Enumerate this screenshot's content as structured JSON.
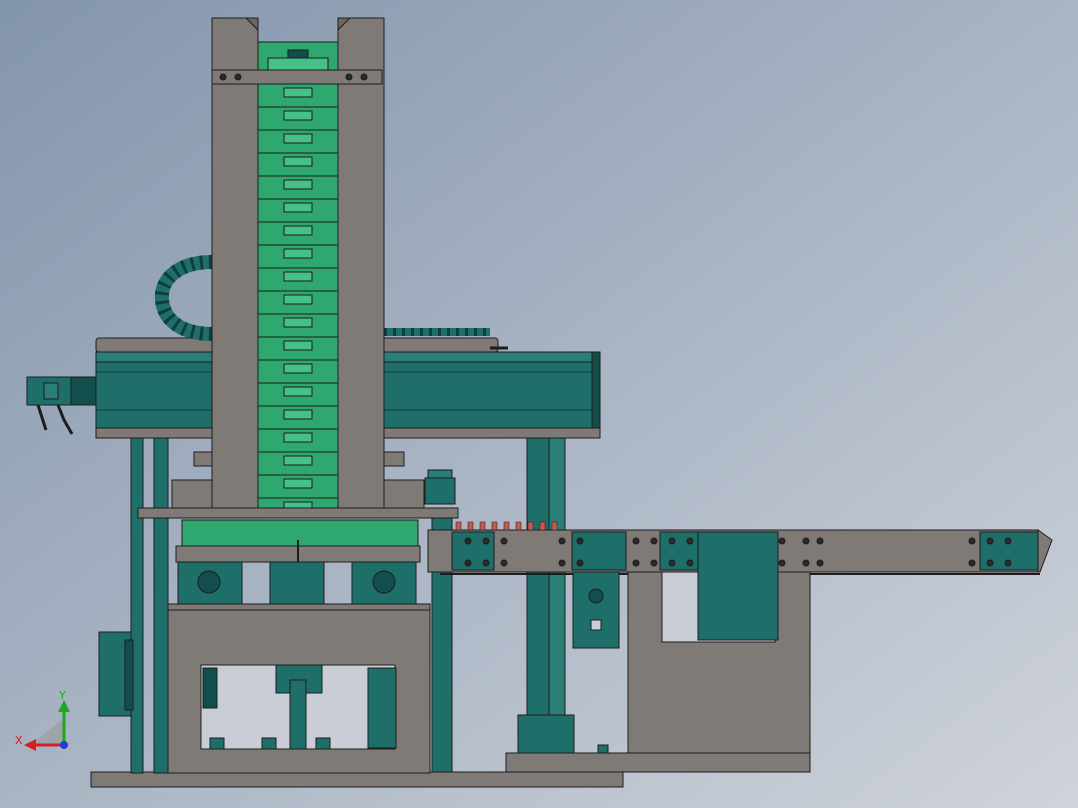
{
  "viewport": {
    "background_top": "#8a9bb0",
    "background_bottom": "#c9ced6"
  },
  "colors": {
    "frame_gray": "#7f7a76",
    "frame_gray_dark": "#6a6561",
    "teal": "#1e6e6a",
    "teal_dark": "#124e4b",
    "green": "#2fa870",
    "green_light": "#45c088",
    "outline": "#1d1d1d"
  },
  "triad": {
    "x_label": "X",
    "y_label": "Y",
    "x_color": "#d42020",
    "y_color": "#1fa81f"
  }
}
